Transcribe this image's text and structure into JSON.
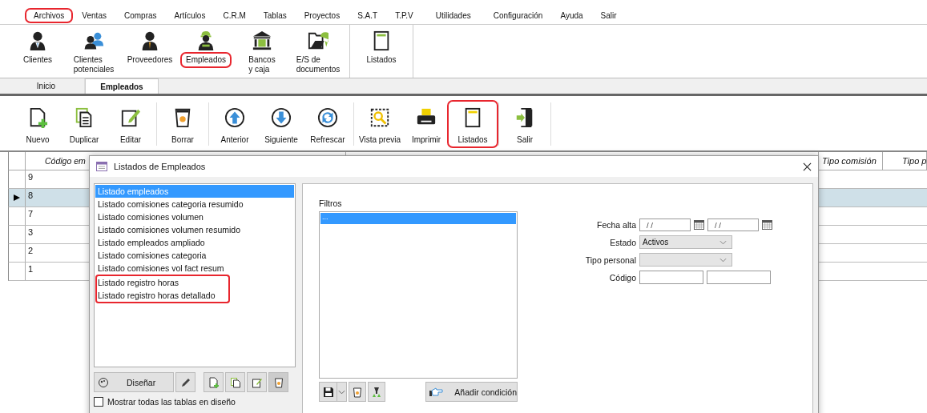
{
  "menu": [
    {
      "label": "Archivos",
      "highlighted": true
    },
    {
      "label": "Ventas",
      "highlighted": false
    },
    {
      "label": "Compras",
      "highlighted": false
    },
    {
      "label": "Artículos",
      "highlighted": false
    },
    {
      "label": "C.R.M",
      "highlighted": false
    },
    {
      "label": "Tablas",
      "highlighted": false
    },
    {
      "label": "Proyectos",
      "highlighted": false
    },
    {
      "label": "S.A.T",
      "highlighted": false
    },
    {
      "label": "T.P.V",
      "highlighted": false
    },
    {
      "label": "Utilidades",
      "highlighted": false
    },
    {
      "label": "Configuración",
      "highlighted": false
    },
    {
      "label": "Ayuda",
      "highlighted": false
    },
    {
      "label": "Salir",
      "highlighted": false
    }
  ],
  "ribbon": [
    {
      "items": [
        {
          "lines": [
            "Clientes"
          ],
          "kind": "person",
          "highlighted": false
        },
        {
          "lines": [
            "Clientes",
            "potenciales"
          ],
          "kind": "people",
          "highlighted": false
        },
        {
          "lines": [
            "Proveedores"
          ],
          "kind": "supplier",
          "highlighted": false
        },
        {
          "lines": [
            "Empleados"
          ],
          "kind": "worker",
          "highlighted": true
        },
        {
          "lines": [
            "Bancos",
            "y caja"
          ],
          "kind": "bank",
          "highlighted": false
        },
        {
          "lines": [
            "E/S de",
            "documentos"
          ],
          "kind": "folder",
          "highlighted": false
        }
      ]
    },
    {
      "items": [
        {
          "lines": [
            "Listados"
          ],
          "kind": "report",
          "highlighted": false
        }
      ]
    }
  ],
  "tabs": [
    {
      "label": "Inicio",
      "selected": false
    },
    {
      "label": "Empleados",
      "selected": true
    }
  ],
  "toolbar": [
    {
      "items": [
        {
          "label": "Nuevo",
          "kind": "new",
          "highlighted": false
        },
        {
          "label": "Duplicar",
          "kind": "copy",
          "highlighted": false
        },
        {
          "label": "Editar",
          "kind": "edit",
          "highlighted": false
        }
      ]
    },
    {
      "items": [
        {
          "label": "Borrar",
          "kind": "delete",
          "highlighted": false
        }
      ]
    },
    {
      "items": [
        {
          "label": "Anterior",
          "kind": "up",
          "highlighted": false
        },
        {
          "label": "Siguiente",
          "kind": "down",
          "highlighted": false
        },
        {
          "label": "Refrescar",
          "kind": "refresh",
          "highlighted": false
        }
      ]
    },
    {
      "items": [
        {
          "label": "Vista previa",
          "kind": "preview",
          "highlighted": false
        },
        {
          "label": "Imprimir",
          "kind": "print",
          "highlighted": false
        },
        {
          "label": "Listados",
          "kind": "report",
          "highlighted": true
        }
      ]
    },
    {
      "items": [
        {
          "label": "Salir",
          "kind": "exit",
          "highlighted": false
        }
      ]
    }
  ],
  "grid": {
    "columns": [
      "Código em",
      "Tipo comisión",
      "Tipo p"
    ],
    "rows": [
      {
        "code": "9",
        "selected": false
      },
      {
        "code": "8",
        "selected": true
      },
      {
        "code": "7",
        "selected": false
      },
      {
        "code": "3",
        "selected": false
      },
      {
        "code": "2",
        "selected": false
      },
      {
        "code": "1",
        "selected": false
      }
    ]
  },
  "dialog": {
    "title": "Listados de Empleados",
    "reports": [
      {
        "label": "Listado empleados",
        "selected": true,
        "highlighted": false
      },
      {
        "label": "Listado comisiones categoria resumido",
        "selected": false,
        "highlighted": false
      },
      {
        "label": "Listado comisiones volumen",
        "selected": false,
        "highlighted": false
      },
      {
        "label": "Listado comisiones volumen resumido",
        "selected": false,
        "highlighted": false
      },
      {
        "label": "Listado empleados ampliado",
        "selected": false,
        "highlighted": false
      },
      {
        "label": "Listado comisiones categoria",
        "selected": false,
        "highlighted": false
      },
      {
        "label": "Listado comisiones vol fact resum",
        "selected": false,
        "highlighted": false
      },
      {
        "label": "Listado registro horas",
        "selected": false,
        "highlighted": true
      },
      {
        "label": "Listado registro horas detallado",
        "selected": false,
        "highlighted": true
      }
    ],
    "design_button": "Diseñar",
    "show_all_tables": {
      "label": "Mostrar todas las tablas en diseño",
      "checked": false
    },
    "filters_label": "Filtros",
    "filters": [
      {
        "label": "...",
        "selected": true
      }
    ],
    "add_condition": "Añadir condición",
    "fecha_alta": {
      "label": "Fecha alta",
      "from": "/ /",
      "to": "/ /"
    },
    "estado": {
      "label": "Estado",
      "value": "Activos"
    },
    "tipo_personal": {
      "label": "Tipo personal"
    },
    "codigo": {
      "label": "Código"
    }
  }
}
